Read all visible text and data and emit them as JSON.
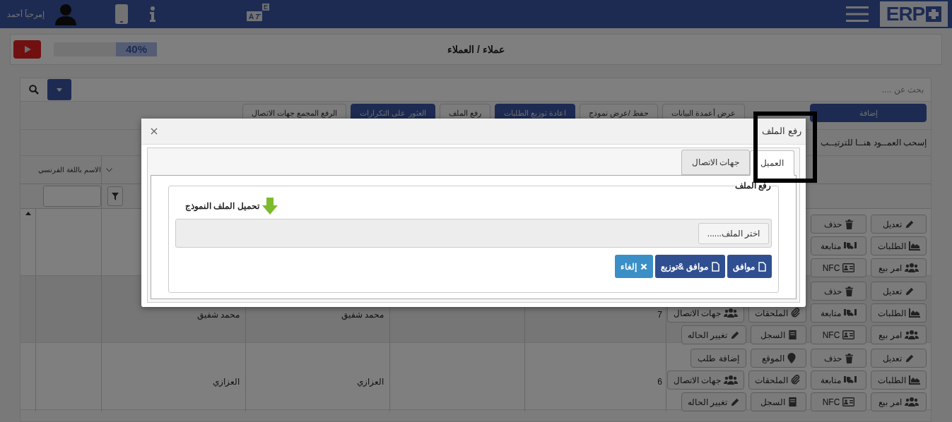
{
  "header": {
    "logo_text": "ERP",
    "greeting": "إمرحباً أحمد",
    "language_badge": "E"
  },
  "page_title": "عملاء / العملاء",
  "progress": {
    "level": 0.4,
    "reading": "40%"
  },
  "search": {
    "placeholder": "بحث عن ...."
  },
  "toolbar": [
    {
      "label": "إضافة",
      "kind": "primary"
    },
    {
      "label": "عرض أعمدة البيانات",
      "kind": "default"
    },
    {
      "label": "حفظ /عرض نموذج",
      "kind": "default"
    },
    {
      "label": "اعادة توزيع الطلبات",
      "kind": "primary"
    },
    {
      "label": "رفع الملف",
      "kind": "default"
    },
    {
      "label": "العثور على التكرارات",
      "kind": "primary"
    },
    {
      "label": "الرفع المجمع جهات الاتصال",
      "kind": "default"
    }
  ],
  "drag_hint": "إسحب العمــود هنــا للترتيــب",
  "table": {
    "column_header": "الاسم باللغة الفرنسي",
    "rows": [
      {
        "action_lines": [
          [
            {
              "label": "تعديل",
              "kind": "edit"
            },
            {
              "label": "حذف",
              "kind": "delete"
            }
          ],
          [
            {
              "label": "الطلبات",
              "kind": "orders"
            },
            {
              "label": "متابعة",
              "kind": "follow"
            }
          ],
          [
            {
              "label": "امر بيع",
              "kind": "sales_order"
            },
            {
              "label": "NFC",
              "kind": "nfc"
            }
          ]
        ]
      },
      {
        "number": "7",
        "name_1": "محمد شفيق",
        "name_2": "محمد شفيق",
        "action_lines": [
          [
            {
              "label": "تعديل",
              "kind": "edit"
            },
            {
              "label": "حذف",
              "kind": "delete"
            }
          ],
          [
            {
              "label": "الطلبات",
              "kind": "orders"
            },
            {
              "label": "متابعة",
              "kind": "follow"
            },
            {
              "label": "الملحقات",
              "kind": "attachments"
            },
            {
              "label": "جهات الاتصال",
              "kind": "contacts"
            }
          ],
          [
            {
              "label": "امر بيع",
              "kind": "sales_order"
            },
            {
              "label": "NFC",
              "kind": "nfc"
            },
            {
              "label": "السجل",
              "kind": "log"
            },
            {
              "label": "تغيير الحاله",
              "kind": "status"
            }
          ]
        ]
      },
      {
        "number": "6",
        "name_1": "العزازي",
        "name_2": "العزازي",
        "action_lines": [
          [
            {
              "label": "تعديل",
              "kind": "edit"
            },
            {
              "label": "حذف",
              "kind": "delete"
            },
            {
              "label": "الموقع",
              "kind": "location"
            },
            {
              "label": "إضافة طلب",
              "kind": "add_order"
            }
          ],
          [
            {
              "label": "الطلبات",
              "kind": "orders"
            },
            {
              "label": "متابعة",
              "kind": "follow"
            },
            {
              "label": "الملحقات",
              "kind": "attachments"
            },
            {
              "label": "جهات الاتصال",
              "kind": "contacts"
            }
          ],
          [
            {
              "label": "امر بيع",
              "kind": "sales_order"
            },
            {
              "label": "NFC",
              "kind": "nfc"
            },
            {
              "label": "السجل",
              "kind": "log"
            },
            {
              "label": "تغيير الحاله",
              "kind": "status"
            }
          ]
        ]
      }
    ]
  },
  "dialog": {
    "title": "رفع الملف",
    "tabs": [
      {
        "label": "العميل",
        "selected": true
      },
      {
        "label": "جهات الاتصال",
        "selected": false
      }
    ],
    "legend": "رفع الملف",
    "download_link": "تحميل الملف النموذج",
    "file_button": "اختر الملف......",
    "buttons": [
      {
        "label": "موافق",
        "kind": "confirm"
      },
      {
        "label": "موافق &توزيع",
        "kind": "confirm"
      },
      {
        "label": "إلغاء",
        "kind": "cancel"
      }
    ]
  }
}
